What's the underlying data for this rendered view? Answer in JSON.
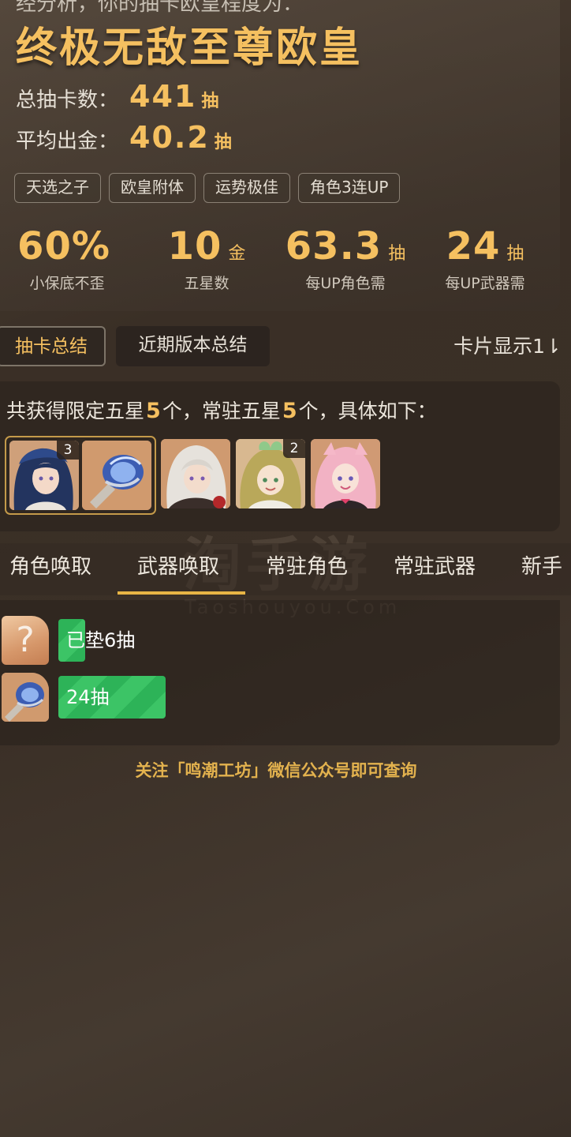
{
  "header": {
    "cut_line": "经分析，你的抽卡欧皇程度为：",
    "title": "终极无敌至尊欧皇",
    "total_label": "总抽卡数：",
    "total_value": "441",
    "total_unit": "抽",
    "avg_label": "平均出金：",
    "avg_value": "40.2",
    "avg_unit": "抽"
  },
  "tags": [
    "天选之子",
    "欧皇附体",
    "运势极佳",
    "角色3连UP"
  ],
  "metrics": [
    {
      "value": "60%",
      "unit": "",
      "caption": "小保底不歪"
    },
    {
      "value": "10",
      "unit": "金",
      "caption": "五星数"
    },
    {
      "value": "63.3",
      "unit": "抽",
      "caption": "每UP角色需"
    },
    {
      "value": "24",
      "unit": "抽",
      "caption": "每UP武器需"
    }
  ],
  "tabs": {
    "summary": "抽卡总结",
    "recent": "近期版本总结",
    "card_display": "卡片显示1⇂"
  },
  "summary": {
    "pre": "共获得限定五星",
    "limited_count": "5",
    "mid": "个，常驻五星",
    "standard_count": "5",
    "post": "个，具体如下："
  },
  "thumbnails": [
    {
      "icon": "character-blue-hair-portrait",
      "count": "3"
    },
    {
      "icon": "weapon-blue-gauntlet",
      "count": ""
    },
    {
      "icon": "character-white-hair-portrait",
      "count": ""
    },
    {
      "icon": "character-green-hair-portrait",
      "count": "2"
    },
    {
      "icon": "character-pink-hair-portrait",
      "count": ""
    }
  ],
  "pool_tabs": [
    "角色唤取",
    "武器唤取",
    "常驻角色",
    "常驻武器",
    "新手"
  ],
  "active_pool_tab": "武器唤取",
  "watermark": {
    "big": "淘手游",
    "small": "Taoshouyou.Com"
  },
  "records": [
    {
      "icon": "unknown-question-icon",
      "avatar_text": "?",
      "label": "已垫6抽",
      "progress": 0.13
    },
    {
      "icon": "weapon-blue-gauntlet",
      "avatar_text": "",
      "label": "24抽",
      "progress": 0.52
    }
  ],
  "footer": "关注「鸣潮工坊」微信公众号即可查询",
  "colors": {
    "accent_gold": "#f5c060",
    "progress_green": "#2db358",
    "tab_underline": "#e8b545"
  }
}
